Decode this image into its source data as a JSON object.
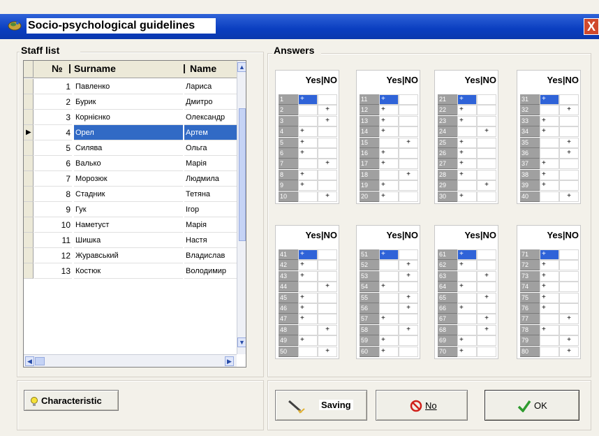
{
  "window": {
    "title": "Socio-psychological guidelines",
    "close_symbol": "X",
    "app_icon": "app-icon"
  },
  "staff_list": {
    "legend": "Staff list",
    "columns": {
      "number": "№",
      "surname": "Surname",
      "name": "Name"
    },
    "selected_index": 3,
    "rows": [
      {
        "number": "1",
        "surname": "Павленко",
        "name": "Лариса"
      },
      {
        "number": "2",
        "surname": "Бурик",
        "name": "Дмитро"
      },
      {
        "number": "3",
        "surname": "Корнієнко",
        "name": "Олександр"
      },
      {
        "number": "4",
        "surname": "Орел",
        "name": "Артем"
      },
      {
        "number": "5",
        "surname": "Силява",
        "name": "Ольга"
      },
      {
        "number": "6",
        "surname": "Валько",
        "name": "Марія"
      },
      {
        "number": "7",
        "surname": "Морозюк",
        "name": "Людмила"
      },
      {
        "number": "8",
        "surname": "Стадник",
        "name": "Тетяна"
      },
      {
        "number": "9",
        "surname": "Гук",
        "name": "Ігор"
      },
      {
        "number": "10",
        "surname": "Наметуст",
        "name": "Марія"
      },
      {
        "number": "11",
        "surname": "Шишка",
        "name": "Настя"
      },
      {
        "number": "12",
        "surname": "Журавський",
        "name": "Владислав"
      },
      {
        "number": "13",
        "surname": "Костюк",
        "name": "Володимир"
      }
    ]
  },
  "answers": {
    "legend": "Answers",
    "header": "Yes|NO",
    "yes_mark": "+",
    "no_mark": "+",
    "blocks": [
      {
        "start": 1,
        "marks": [
          "sel",
          "n",
          "n",
          "y",
          "y",
          "y",
          "n",
          "y",
          "y",
          "n"
        ]
      },
      {
        "start": 11,
        "marks": [
          "sel",
          "y",
          "y",
          "y",
          "n",
          "y",
          "y",
          "n",
          "y",
          "y"
        ]
      },
      {
        "start": 21,
        "marks": [
          "sel",
          "y",
          "y",
          "n",
          "y",
          "y",
          "y",
          "y",
          "n",
          "y"
        ]
      },
      {
        "start": 31,
        "marks": [
          "sel",
          "n",
          "y",
          "y",
          "n",
          "n",
          "y",
          "y",
          "y",
          "n"
        ]
      },
      {
        "start": 41,
        "marks": [
          "sel",
          "y",
          "y",
          "n",
          "y",
          "y",
          "y",
          "n",
          "y",
          "n"
        ]
      },
      {
        "start": 51,
        "marks": [
          "sel",
          "n",
          "n",
          "y",
          "n",
          "n",
          "y",
          "n",
          "y",
          "y"
        ]
      },
      {
        "start": 61,
        "marks": [
          "sel",
          "y",
          "n",
          "y",
          "n",
          "y",
          "n",
          "n",
          "y",
          "y"
        ]
      },
      {
        "start": 71,
        "marks": [
          "sel",
          "y",
          "y",
          "y",
          "y",
          "y",
          "n",
          "y",
          "n",
          "n"
        ]
      }
    ]
  },
  "buttons": {
    "characteristic": "Characteristic",
    "saving": "Saving",
    "no": "No",
    "ok": "OK"
  },
  "colors": {
    "titlebar": "#0a3ec0",
    "selection": "#316ac5",
    "answer_selection": "#2f63d8",
    "ok_check": "#2e9b2e",
    "no_icon": "#d0201a"
  }
}
